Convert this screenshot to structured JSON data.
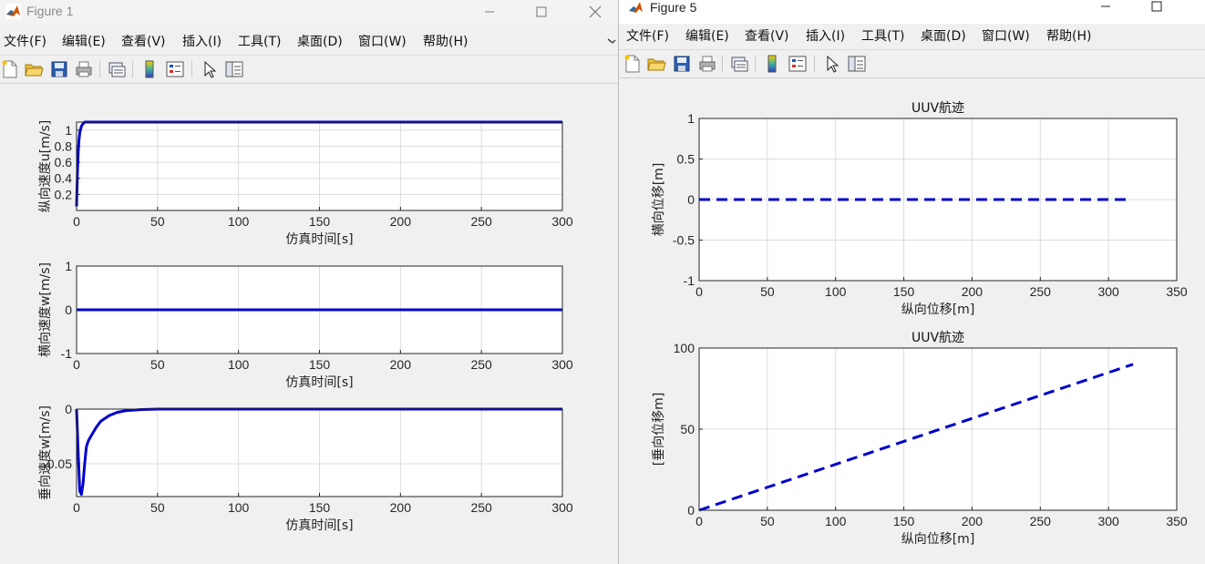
{
  "figure1": {
    "title": "Figure 1",
    "menu": [
      "文件(F)",
      "编辑(E)",
      "查看(V)",
      "插入(I)",
      "工具(T)",
      "桌面(D)",
      "窗口(W)",
      "帮助(H)"
    ],
    "toolbar_icons": [
      "new-file-icon",
      "open-folder-icon",
      "save-icon",
      "print-icon",
      "link-icon",
      "colorbar-icon",
      "legend-icon",
      "pointer-icon",
      "property-editor-icon"
    ]
  },
  "figure5": {
    "title": "Figure 5",
    "menu": [
      "文件(F)",
      "编辑(E)",
      "查看(V)",
      "插入(I)",
      "工具(T)",
      "桌面(D)",
      "窗口(W)",
      "帮助(H)"
    ],
    "toolbar_icons": [
      "new-file-icon",
      "open-folder-icon",
      "save-icon",
      "print-icon",
      "link-icon",
      "colorbar-icon",
      "legend-icon",
      "pointer-icon",
      "property-editor-icon"
    ]
  },
  "colors": {
    "line": "#0000cc",
    "grid": "#dcdcdc",
    "axis": "#262626"
  },
  "chart_data": [
    {
      "type": "line",
      "figure": "Figure 1",
      "title": "",
      "xlabel": "仿真时间[s]",
      "ylabel": "纵向速度u[m/s]",
      "xlim": [
        0,
        300
      ],
      "ylim": [
        0,
        1.1
      ],
      "xticks": [
        "0",
        "50",
        "100",
        "150",
        "200",
        "250",
        "300"
      ],
      "yticks": [
        "0.2",
        "0.4",
        "0.6",
        "0.8",
        "1"
      ],
      "ytick_values": [
        0.2,
        0.4,
        0.6,
        0.8,
        1.0
      ],
      "grid": true,
      "series": [
        {
          "x": [
            0,
            0.5,
            1,
            1.5,
            2,
            3,
            4,
            5,
            300
          ],
          "y": [
            0.05,
            0.45,
            0.72,
            0.88,
            0.97,
            1.05,
            1.08,
            1.1,
            1.1
          ],
          "style": "solid"
        }
      ]
    },
    {
      "type": "line",
      "figure": "Figure 1",
      "title": "",
      "xlabel": "仿真时间[s]",
      "ylabel": "横向速度w[m/s]",
      "xlim": [
        0,
        300
      ],
      "ylim": [
        -1,
        1
      ],
      "xticks": [
        "0",
        "50",
        "100",
        "150",
        "200",
        "250",
        "300"
      ],
      "yticks": [
        "-1",
        "0",
        "1"
      ],
      "ytick_values": [
        -1,
        0,
        1
      ],
      "grid": true,
      "series": [
        {
          "x": [
            0,
            300
          ],
          "y": [
            0,
            0
          ],
          "style": "solid"
        }
      ]
    },
    {
      "type": "line",
      "figure": "Figure 1",
      "title": "",
      "xlabel": "仿真时间[s]",
      "ylabel": "垂向速度w[m/s]",
      "xlim": [
        0,
        300
      ],
      "ylim": [
        -0.08,
        0
      ],
      "xticks": [
        "0",
        "50",
        "100",
        "150",
        "200",
        "250",
        "300"
      ],
      "yticks": [
        "-0.05",
        "0"
      ],
      "ytick_values": [
        -0.05,
        0
      ],
      "grid": true,
      "series": [
        {
          "x": [
            0,
            1,
            2,
            3,
            4,
            5,
            6,
            7,
            8,
            10,
            12,
            15,
            20,
            25,
            30,
            40,
            50,
            300
          ],
          "y": [
            0,
            -0.04,
            -0.075,
            -0.078,
            -0.068,
            -0.05,
            -0.035,
            -0.03,
            -0.027,
            -0.022,
            -0.017,
            -0.011,
            -0.006,
            -0.003,
            -0.0015,
            -0.0004,
            0,
            0
          ],
          "style": "solid"
        }
      ]
    },
    {
      "type": "line",
      "figure": "Figure 5",
      "title": "UUV航迹",
      "xlabel": "纵向位移[m]",
      "ylabel": "横向位移[m]",
      "xlim": [
        0,
        350
      ],
      "ylim": [
        -1,
        1
      ],
      "xticks": [
        "0",
        "50",
        "100",
        "150",
        "200",
        "250",
        "300",
        "350"
      ],
      "yticks": [
        "-1",
        "-0.5",
        "0",
        "0.5",
        "1"
      ],
      "ytick_values": [
        -1,
        -0.5,
        0,
        0.5,
        1
      ],
      "grid": true,
      "series": [
        {
          "x": [
            0,
            313
          ],
          "y": [
            0,
            0
          ],
          "style": "dashed"
        }
      ]
    },
    {
      "type": "line",
      "figure": "Figure 5",
      "title": "UUV航迹",
      "xlabel": "纵向位移[m]",
      "ylabel": "[垂向位移m]",
      "xlim": [
        0,
        350
      ],
      "ylim": [
        0,
        100
      ],
      "xticks": [
        "0",
        "50",
        "100",
        "150",
        "200",
        "250",
        "300",
        "350"
      ],
      "yticks": [
        "0",
        "50",
        "100"
      ],
      "ytick_values": [
        0,
        50,
        100
      ],
      "grid": true,
      "series": [
        {
          "x": [
            0,
            318
          ],
          "y": [
            0,
            90
          ],
          "style": "dashed"
        }
      ]
    }
  ]
}
